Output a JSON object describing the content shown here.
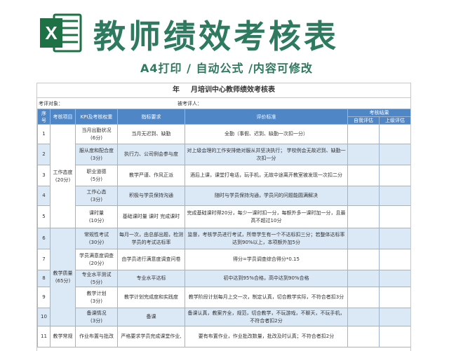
{
  "banner": {
    "app_icon": "excel-logo-icon",
    "logo_letter": "X",
    "title": "教师绩效考核表",
    "subtitle": "A4打印 / 自动公式 /内容可修改",
    "brand_color": "#2d7a5f"
  },
  "sheet": {
    "title_year": "年",
    "title_rest": "月培训中心教师绩效考核表",
    "assessee_label": "考评对象：",
    "assessor_label": "被考评人：",
    "header": {
      "no": "序号",
      "item": "考核项目",
      "kpi": "KPI及考核权重",
      "indicator": "指标要求",
      "standard": "评价标准",
      "result": "考核结果",
      "self": "自我评估",
      "superior": "上级评估"
    },
    "categories": {
      "attitude": "工作态度\n(20分)",
      "quality": "教学质量\n(65分)",
      "routine": "教学常规"
    },
    "rows": [
      {
        "no": "1",
        "kpi": "当月出勤状况\n(6分)",
        "indicator": "当月无迟到、缺勤",
        "standard": "全勤（事假、迟到、缺勤一次扣一分）"
      },
      {
        "no": "2",
        "kpi": "服从度和配合度\n(3分)",
        "indicator": "执行力、公司例会参与度",
        "standard": "对上级会理的工作安排绝对服从并坚决执行；                学校例会无故迟到、缺勤一次扣一分"
      },
      {
        "no": "3",
        "kpi": "职业道德\n(5分)",
        "indicator": "教学严谨、作风正派",
        "standard": "酒后上课，课堂打电话，玩手机，无故中途离开教室被发现一次扣二分"
      },
      {
        "no": "4",
        "kpi": "工作心态\n(3分)",
        "indicator": "积极与学员保持沟通",
        "standard": "随时与学员保持沟通，学员问的问题能圆满解决"
      },
      {
        "no": "5",
        "kpi": "课时量\n(10分)",
        "indicator": "基础课时量        课时        完成课时",
        "standard": "完成基础课时得20分，每少一课时扣一分，每额外多一课时加一分，且最高不超过10分"
      },
      {
        "no": "6",
        "kpi": "常规性考试\n(30分)",
        "indicator": "每月一次，由总部出题，检测学员的考试达标率",
        "standard": "监督，考核学员进行考试，所带学生有一个不达标扣三分；若整体达标率达到90%以上，本项额外加5分"
      },
      {
        "no": "7",
        "kpi": "学员满意度调查\n(20分)",
        "indicator": "由学员进行满意度调查问卷",
        "standard": "得分=学员调查综合得分*0.15"
      },
      {
        "no": "8",
        "kpi": "专业水平测试\n(5分)",
        "indicator": "专业水平达标",
        "standard": "初中达到95%合格，高中达到90%合格"
      },
      {
        "no": "9",
        "kpi": "教学计划\n(3分)",
        "indicator": "教学计划完成度和实践度",
        "standard": "教学阶段计划每月上交一次，制定认真，切合教学实际，不符合者扣3分"
      },
      {
        "no": "10",
        "kpi": "备课情况\n(3分)",
        "indicator": "备课",
        "standard": "备课认真，教案齐全，规范，切合教学，不玩游戏，不聊天，不玩手机，不符合者扣2分"
      },
      {
        "no": "11",
        "kpi": "作业布置与批改",
        "indicator": "严格要求学员完成课堂作业,",
        "standard": "要有布置作业，作业批改数量，批改及时认真；不符合者扣2分"
      }
    ]
  }
}
